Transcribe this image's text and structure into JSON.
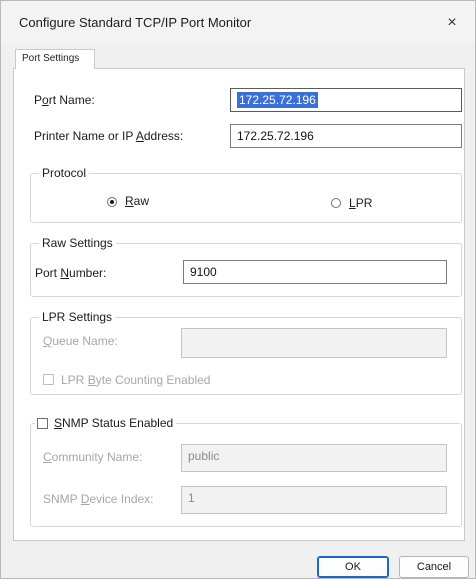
{
  "window": {
    "title": "Configure Standard TCP/IP Port Monitor",
    "close_glyph": "×"
  },
  "tab": {
    "label": "Port Settings"
  },
  "port_name": {
    "label_pre": "P",
    "label_ul": "o",
    "label_post": "rt Name:",
    "value": "172.25.72.196"
  },
  "printer_address": {
    "label_pre": "Printer Name or IP ",
    "label_ul": "A",
    "label_post": "ddress:",
    "value": "172.25.72.196"
  },
  "protocol": {
    "title": "Protocol",
    "raw": {
      "label_ul": "R",
      "label_post": "aw",
      "selected": true
    },
    "lpr": {
      "label_ul": "L",
      "label_post": "PR",
      "selected": false
    }
  },
  "raw_settings": {
    "title": "Raw Settings",
    "port_number": {
      "label_pre": "Port ",
      "label_ul": "N",
      "label_post": "umber:",
      "value": "9100"
    }
  },
  "lpr_settings": {
    "title": "LPR Settings",
    "queue_name": {
      "label_ul": "Q",
      "label_post": "ueue Name:",
      "value": ""
    },
    "byte_counting": {
      "label_pre": "LPR ",
      "label_ul": "B",
      "label_post": "yte Counting Enabled",
      "checked": false
    }
  },
  "snmp": {
    "title_ul": "S",
    "title_post": "NMP Status Enabled",
    "checked": false,
    "community": {
      "label_ul": "C",
      "label_post": "ommunity Name:",
      "value": "public"
    },
    "device_index": {
      "label_pre": "SNMP ",
      "label_ul": "D",
      "label_post": "evice Index:",
      "value": "1"
    }
  },
  "buttons": {
    "ok": "OK",
    "cancel": "Cancel"
  }
}
